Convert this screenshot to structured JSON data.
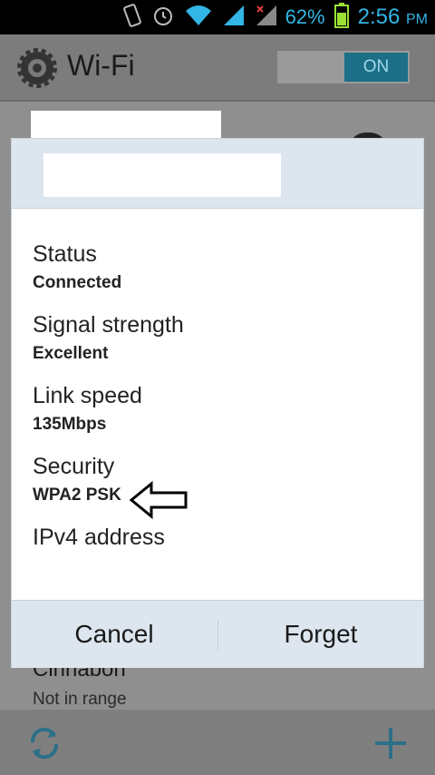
{
  "status_bar": {
    "battery_percent": "62%",
    "time": "2:56",
    "ampm": "PM",
    "icons": [
      "vibrate-icon",
      "alarm-icon",
      "wifi-icon",
      "signal-icon",
      "signal-no-data-icon",
      "battery-icon"
    ]
  },
  "action_bar": {
    "title": "Wi-Fi",
    "toggle_label": "ON",
    "icon": "settings-gear-icon"
  },
  "background_list": {
    "network_name": "Cinnabon",
    "network_status": "Not in range"
  },
  "dialog": {
    "fields": [
      {
        "label": "Status",
        "value": "Connected"
      },
      {
        "label": "Signal strength",
        "value": "Excellent"
      },
      {
        "label": "Link speed",
        "value": "135Mbps"
      },
      {
        "label": "Security",
        "value": "WPA2 PSK"
      },
      {
        "label": "IPv4 address",
        "value": ""
      }
    ],
    "cancel_label": "Cancel",
    "forget_label": "Forget"
  },
  "bottom_bar": {
    "icons": [
      "refresh-icon",
      "add-icon"
    ]
  },
  "colors": {
    "accent": "#33b5e5",
    "dialog_header": "#dde6ef",
    "toggle_on": "#1c6f86"
  }
}
